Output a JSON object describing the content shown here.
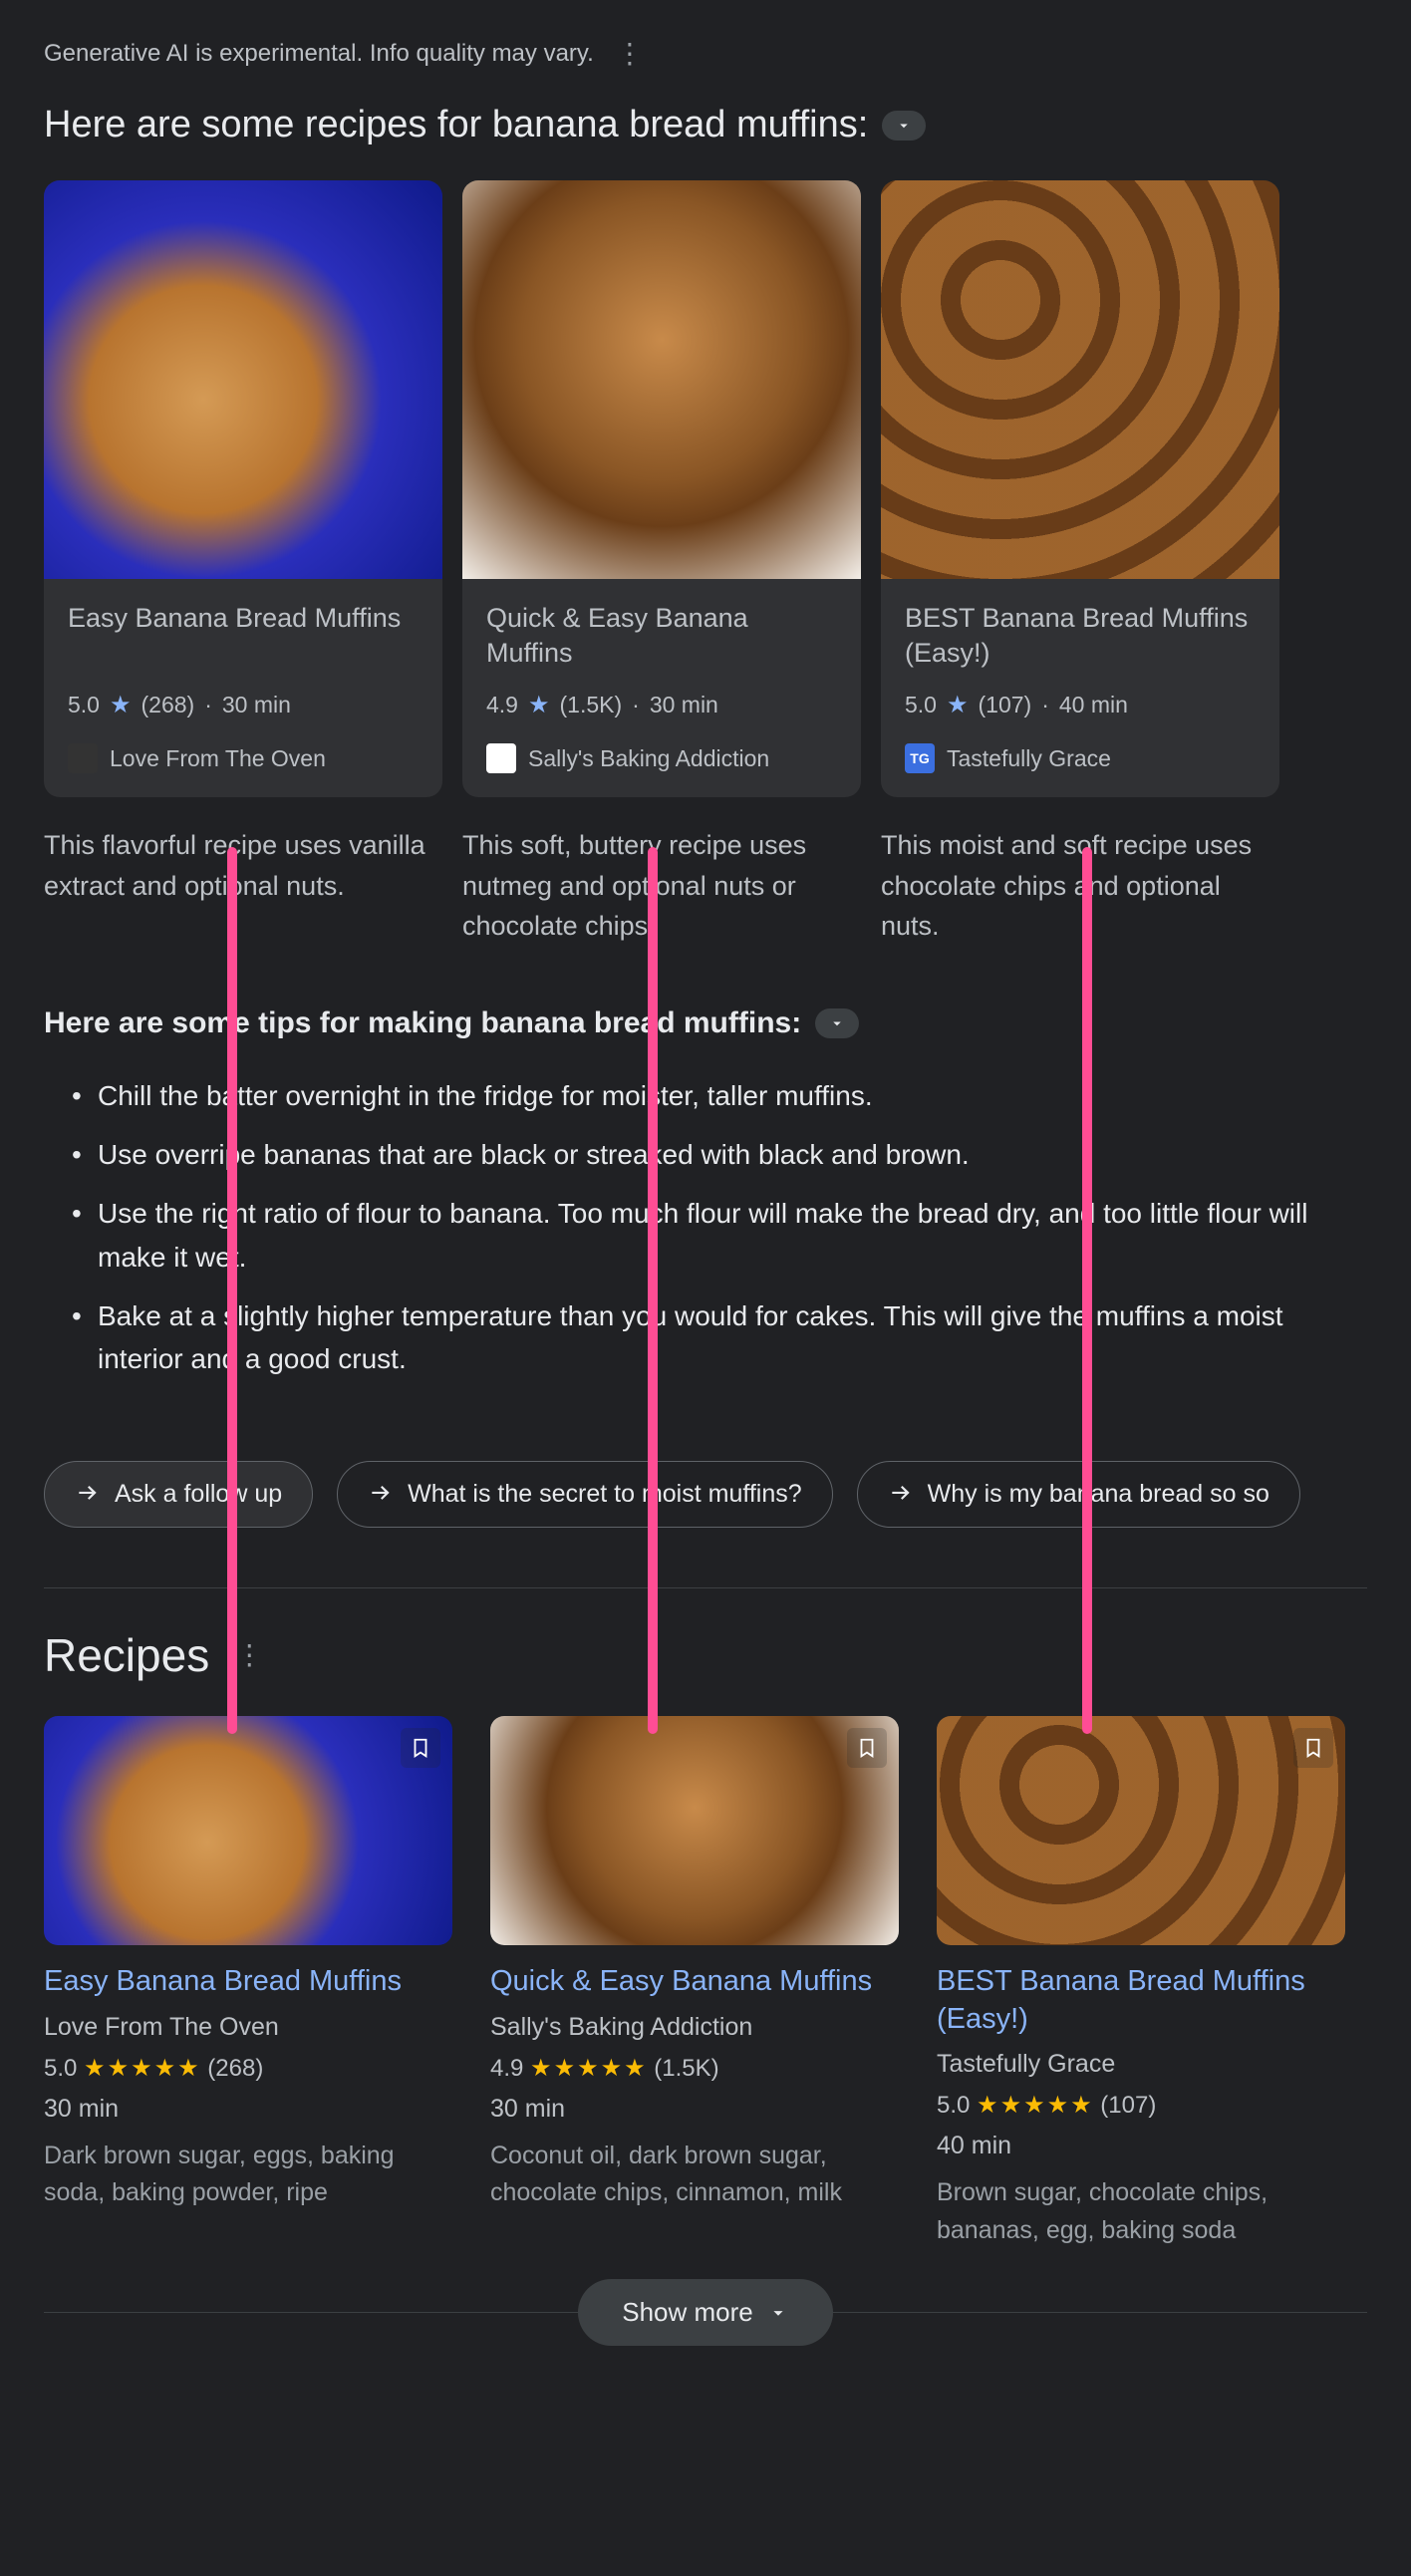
{
  "disclaimer": "Generative AI is experimental. Info quality may vary.",
  "intro_heading": "Here are some recipes for banana bread muffins:",
  "ai_cards": [
    {
      "title": "Easy Banana Bread Muffins",
      "rating": "5.0",
      "reviews": "(268)",
      "duration": "30 min",
      "source": "Love From The Oven",
      "desc": "This flavorful recipe uses vanilla extract and optional nuts."
    },
    {
      "title": "Quick & Easy Banana Muffins",
      "rating": "4.9",
      "reviews": "(1.5K)",
      "duration": "30 min",
      "source": "Sally's Baking Addiction",
      "desc": "This soft, buttery recipe uses nutmeg and optional nuts or chocolate chips."
    },
    {
      "title": "BEST Banana Bread Muffins (Easy!)",
      "rating": "5.0",
      "reviews": "(107)",
      "duration": "40 min",
      "source": "Tastefully Grace",
      "source_badge": "TG",
      "desc": "This moist and soft recipe uses chocolate chips and optional nuts."
    }
  ],
  "tips_heading": "Here are some tips for making banana bread muffins:",
  "tips": [
    "Chill the batter overnight in the fridge for moister, taller muffins.",
    "Use overripe bananas that are black or streaked with black and brown.",
    "Use the right ratio of flour to banana. Too much flour will make the bread dry, and too little flour will make it wet.",
    "Bake at a slightly higher temperature than you would for cakes. This will give the muffins a moist interior and a good crust."
  ],
  "chips": [
    "Ask a follow up",
    "What is the secret to moist muffins?",
    "Why is my banana bread so so"
  ],
  "recipes_heading": "Recipes",
  "recipes": [
    {
      "title": "Easy Banana Bread Muffins",
      "source": "Love From The Oven",
      "rating": "5.0",
      "reviews": "(268)",
      "duration": "30 min",
      "ingredients": "Dark brown sugar, eggs, baking soda, baking powder, ripe"
    },
    {
      "title": "Quick & Easy Banana Muffins",
      "source": "Sally's Baking Addiction",
      "rating": "4.9",
      "reviews": "(1.5K)",
      "duration": "30 min",
      "ingredients": "Coconut oil, dark brown sugar, chocolate chips, cinnamon, milk"
    },
    {
      "title": "BEST Banana Bread Muffins (Easy!)",
      "source": "Tastefully Grace",
      "rating": "5.0",
      "reviews": "(107)",
      "duration": "40 min",
      "ingredients": "Brown sugar, chocolate chips, bananas, egg, baking soda"
    }
  ],
  "show_more": "Show more",
  "dot_sep": " · ",
  "star_glyph": "★",
  "five_stars": "★★★★★"
}
